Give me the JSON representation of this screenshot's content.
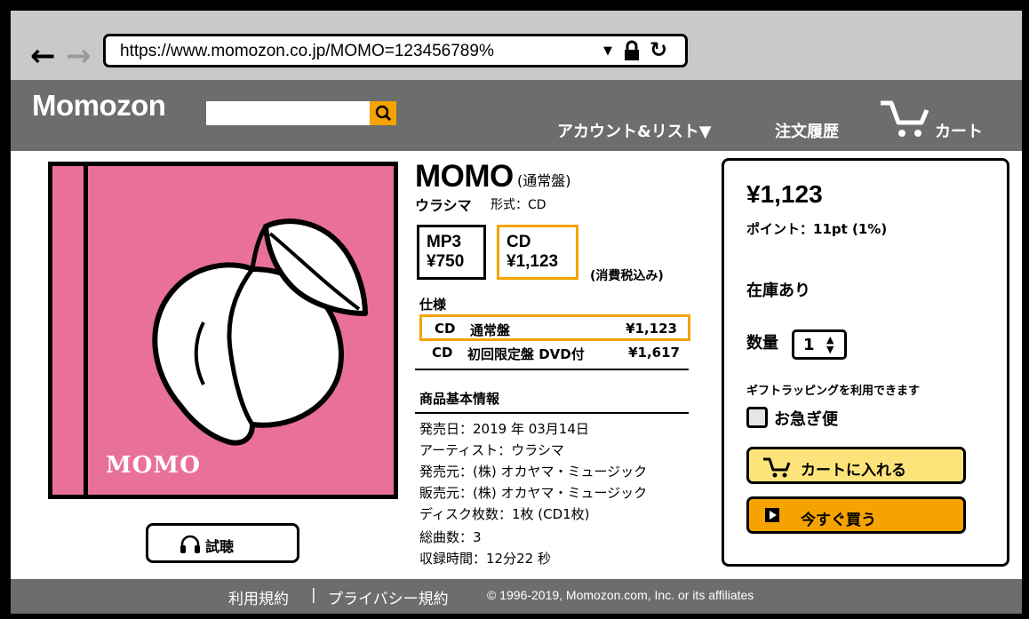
{
  "browser": {
    "url": "https://www.momozon.co.jp/MOMO=123456789%",
    "back_icon": "arrow-left-icon",
    "forward_icon": "arrow-right-icon",
    "dropdown_glyph": "▼",
    "reload_glyph": "↻"
  },
  "header": {
    "logo": "Momozon",
    "search_placeholder": "",
    "account": "アカウント&リスト▼",
    "orders": "注文履歴",
    "cart": "カート"
  },
  "product": {
    "cover_title": "MOMO",
    "title": "MOMO",
    "edition": "(通常盤)",
    "artist": "ウラシマ",
    "format": "形式：CD",
    "formats": [
      {
        "name": "MP3",
        "price": "¥750"
      },
      {
        "name": "CD",
        "price": "¥1,123"
      }
    ],
    "tax_note": "(消費税込み)",
    "spec_title": "仕様",
    "specs": [
      {
        "type": "CD",
        "edition": "通常盤",
        "price": "¥1,123"
      },
      {
        "type": "CD",
        "edition": "初回限定盤 DVD付",
        "price": "¥1,617"
      }
    ],
    "info_title": "商品基本情報",
    "info": [
      "発売日：2019 年 03月14日",
      "アーティスト：ウラシマ",
      "発売元：(株) オカヤマ・ミュージック",
      "販売元：(株) オカヤマ・ミュージック",
      "ディスク枚数：1枚 (CD1枚)",
      "総曲数：3",
      "収録時間：12分22 秒"
    ],
    "listen_label": "試聴"
  },
  "buybox": {
    "price": "¥1,123",
    "points": "ポイント：11pt (1%)",
    "stock": "在庫あり",
    "qty_label": "数量",
    "qty_value": "1",
    "gift": "ギフトラッピングを利用できます",
    "express": "お急ぎ便",
    "add_to_cart": "カートに入れる",
    "buy_now": "今すぐ買う"
  },
  "footer": {
    "terms": "利用規約",
    "separator": "|",
    "privacy": "プライバシー規約",
    "copyright": "© 1996-2019, Momozon.com, Inc. or its affiliates"
  },
  "colors": {
    "accent": "#f4a300",
    "cover_pink": "#e97099",
    "header_gray": "#6d6d6d",
    "browser_gray": "#c9c9c9",
    "cart_button": "#fde47a"
  }
}
